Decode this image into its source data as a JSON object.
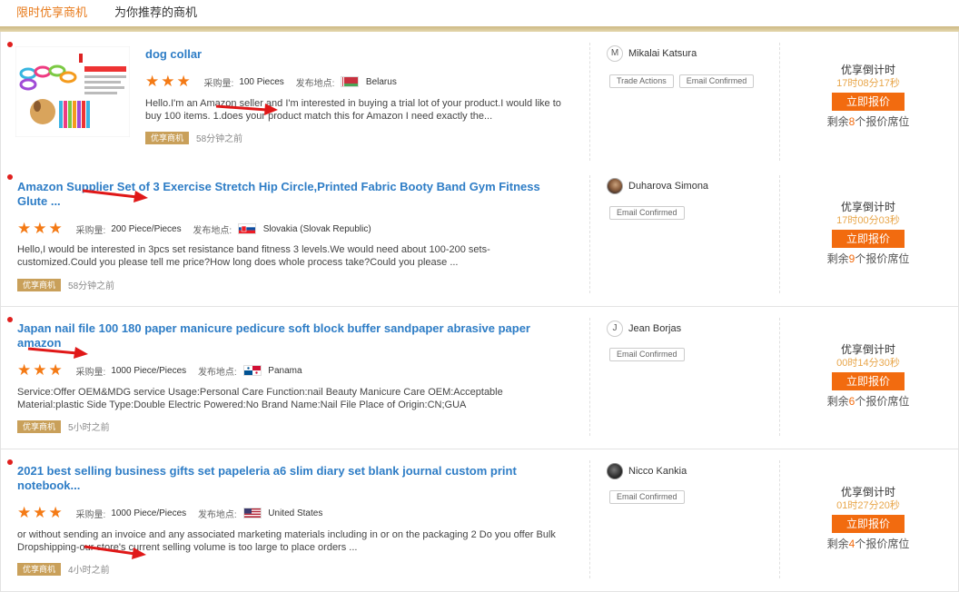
{
  "tabs": [
    {
      "label": "限时优享商机"
    },
    {
      "label": "为你推荐的商机"
    }
  ],
  "listings": [
    {
      "title": "dog collar",
      "purchase_label": "采购量:",
      "purchase_qty": "100 Pieces",
      "location_label": "发布地点:",
      "country": "Belarus",
      "description": "Hello.I'm an Amazon seller and I'm interested in buying a trial lot of your product.I would like to buy 100 items. 1.does your product match this for Amazon I need exactly the...",
      "badge": "优享商机",
      "posted": "58分钟之前",
      "buyer_initial": "M",
      "buyer_name": "Mikalai Katsura",
      "chips": [
        "Trade Actions",
        "Email Confirmed"
      ],
      "countdown_label": "优享倒计时",
      "countdown": "17时08分17秒",
      "quote_button": "立即报价",
      "remaining_prefix": "剩余",
      "remaining_count": "8",
      "remaining_suffix": "个报价席位"
    },
    {
      "title": "Amazon Supplier Set of 3 Exercise Stretch Hip Circle,Printed Fabric Booty Band Gym Fitness Glute ...",
      "purchase_label": "采购量:",
      "purchase_qty": "200 Piece/Pieces",
      "location_label": "发布地点:",
      "country": "Slovakia (Slovak Republic)",
      "description": "Hello,I would be interested in 3pcs set resistance band fitness 3 levels.We would need about 100-200 sets-customized.Could you please tell me price?How long does whole process take?Could you please ...",
      "badge": "优享商机",
      "posted": "58分钟之前",
      "buyer_initial": "",
      "buyer_name": "Duharova Simona",
      "chips": [
        "Email Confirmed"
      ],
      "countdown_label": "优享倒计时",
      "countdown": "17时00分03秒",
      "quote_button": "立即报价",
      "remaining_prefix": "剩余",
      "remaining_count": "9",
      "remaining_suffix": "个报价席位"
    },
    {
      "title": "Japan nail file 100 180 paper manicure pedicure soft block buffer sandpaper abrasive paper amazon",
      "purchase_label": "采购量:",
      "purchase_qty": "1000 Piece/Pieces",
      "location_label": "发布地点:",
      "country": "Panama",
      "description": "Service:Offer OEM&MDG service Usage:Personal Care Function:nail Beauty Manicure Care OEM:Acceptable Material:plastic Side Type:Double Electric Powered:No Brand Name:Nail File Place of Origin:CN;GUA",
      "badge": "优享商机",
      "posted": "5小时之前",
      "buyer_initial": "J",
      "buyer_name": "Jean Borjas",
      "chips": [
        "Email Confirmed"
      ],
      "countdown_label": "优享倒计时",
      "countdown": "00时14分30秒",
      "quote_button": "立即报价",
      "remaining_prefix": "剩余",
      "remaining_count": "6",
      "remaining_suffix": "个报价席位"
    },
    {
      "title": "2021 best selling business gifts set papeleria a6 slim diary set blank journal custom print notebook...",
      "purchase_label": "采购量:",
      "purchase_qty": "1000 Piece/Pieces",
      "location_label": "发布地点:",
      "country": "United States",
      "description": "or without sending an invoice and any associated marketing materials including in or on the packaging 2 Do you offer Bulk Dropshipping-our store's current selling volume is too large to place orders ...",
      "badge": "优享商机",
      "posted": "4小时之前",
      "buyer_initial": "",
      "buyer_name": "Nicco Kankia",
      "chips": [
        "Email Confirmed"
      ],
      "countdown_label": "优享倒计时",
      "countdown": "01时27分20秒",
      "quote_button": "立即报价",
      "remaining_prefix": "剩余",
      "remaining_count": "4",
      "remaining_suffix": "个报价席位"
    }
  ]
}
